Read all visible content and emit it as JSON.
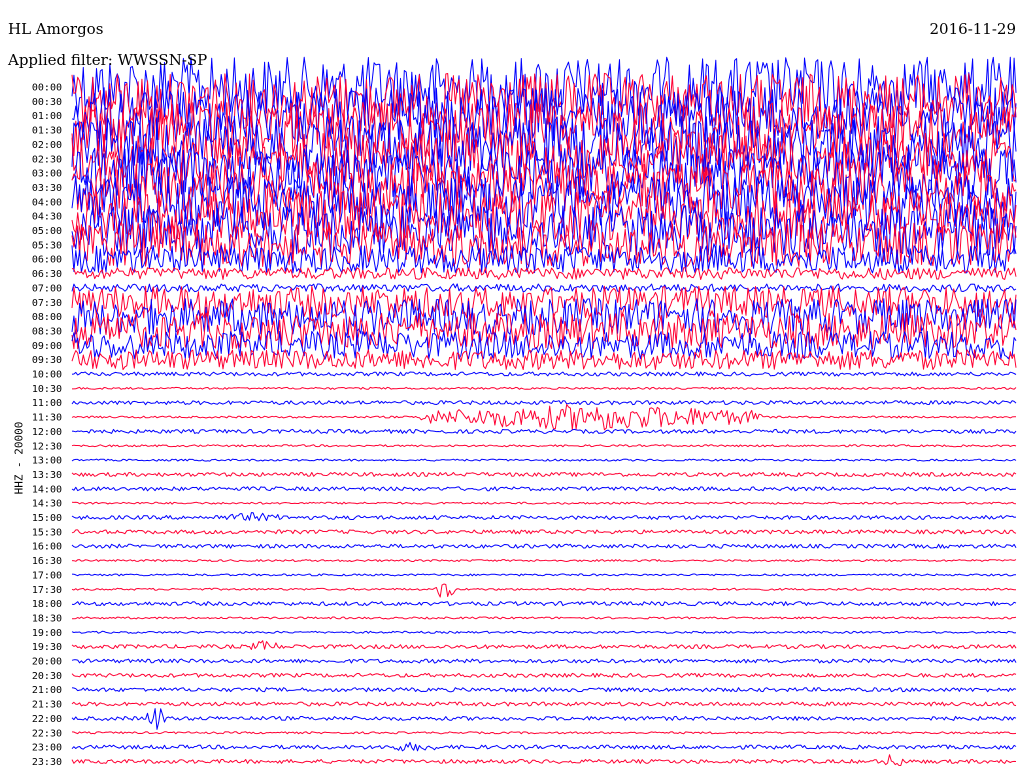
{
  "header": {
    "station": "HL Amorgos",
    "date": "2016-11-29",
    "filter": "Applied filter: WWSSN-SP"
  },
  "chart_data": {
    "type": "line",
    "title": "HL Amorgos",
    "ylabel": "HHZ - 20000",
    "colors": [
      "#0000ff",
      "#ff0033"
    ],
    "rows": [
      "00:00",
      "00:30",
      "01:00",
      "01:30",
      "02:00",
      "02:30",
      "03:00",
      "03:30",
      "04:00",
      "04:30",
      "05:00",
      "05:30",
      "06:00",
      "06:30",
      "07:00",
      "07:30",
      "08:00",
      "08:30",
      "09:00",
      "09:30",
      "10:00",
      "10:30",
      "11:00",
      "11:30",
      "12:00",
      "12:30",
      "13:00",
      "13:30",
      "14:00",
      "14:30",
      "15:00",
      "15:30",
      "16:00",
      "16:30",
      "17:00",
      "17:30",
      "18:00",
      "18:30",
      "19:00",
      "19:30",
      "20:00",
      "20:30",
      "21:00",
      "21:30",
      "22:00",
      "22:30",
      "23:00",
      "23:30"
    ],
    "amplitude": [
      30,
      28,
      28,
      28,
      28,
      26,
      26,
      26,
      26,
      25,
      25,
      22,
      14,
      6,
      4,
      16,
      18,
      18,
      14,
      10,
      2,
      1,
      2,
      1,
      2,
      1,
      1,
      2,
      2,
      1,
      2,
      2,
      2,
      1,
      1,
      1,
      2,
      1,
      1,
      2,
      2,
      2,
      2,
      2,
      2,
      1,
      2,
      2
    ],
    "events": [
      {
        "row": "11:30",
        "start": 0.37,
        "end": 0.73,
        "amp": 14
      },
      {
        "row": "15:00",
        "start": 0.15,
        "end": 0.23,
        "amp": 5
      },
      {
        "row": "17:30",
        "start": 0.385,
        "end": 0.405,
        "amp": 12
      },
      {
        "row": "19:30",
        "start": 0.19,
        "end": 0.22,
        "amp": 7
      },
      {
        "row": "22:00",
        "start": 0.08,
        "end": 0.1,
        "amp": 14
      },
      {
        "row": "23:00",
        "start": 0.33,
        "end": 0.39,
        "amp": 5
      },
      {
        "row": "23:30",
        "start": 0.86,
        "end": 0.88,
        "amp": 9
      }
    ]
  }
}
